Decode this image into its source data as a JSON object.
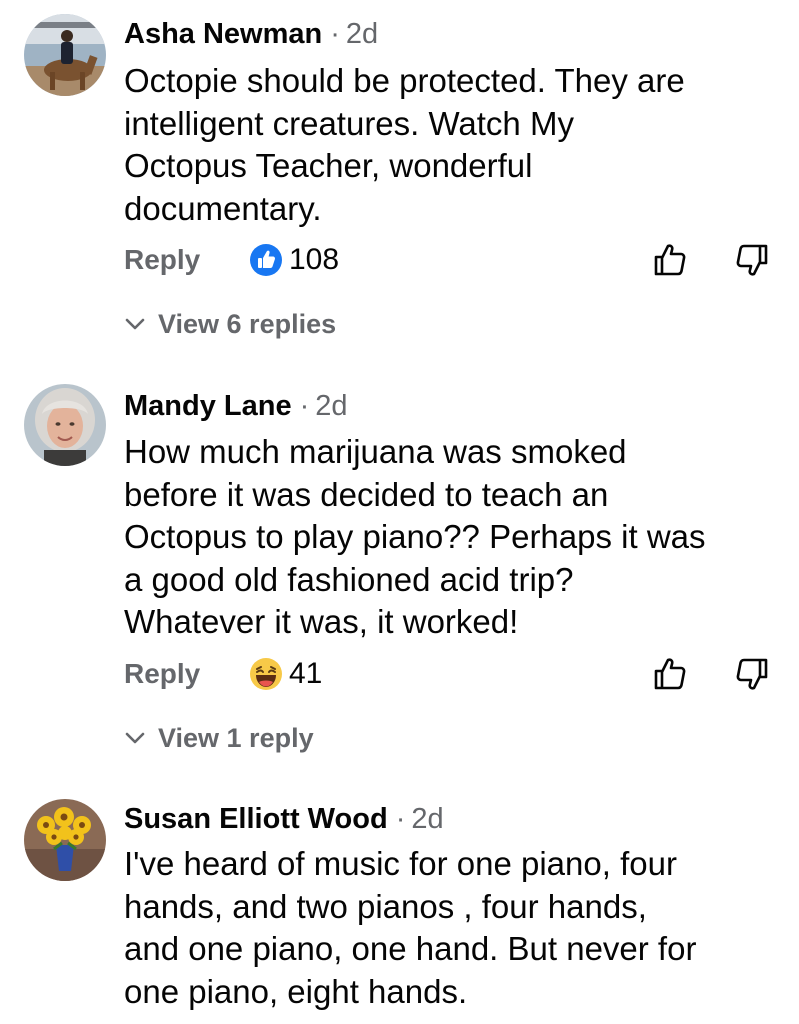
{
  "comments": [
    {
      "author": "Asha Newman",
      "separator": "·",
      "age": "2d",
      "avatar_icon": "person-with-horse-avatar",
      "lines": [
        "Octopie should be protected. They are",
        "intelligent creatures. Watch My",
        "Octopus Teacher, wonderful",
        "documentary."
      ],
      "reply_label": "Reply",
      "reaction_icon": "like-reaction-icon",
      "reaction_count": "108",
      "view_replies_label": "View 6 replies"
    },
    {
      "author": "Mandy Lane",
      "separator": "·",
      "age": "2d",
      "avatar_icon": "woman-portrait-avatar",
      "lines": [
        "How much marijuana was smoked",
        "before it was decided to teach an",
        "Octopus to play piano?? Perhaps it was",
        "a good old fashioned acid trip?",
        "Whatever it was, it worked!"
      ],
      "reply_label": "Reply",
      "reaction_icon": "haha-reaction-icon",
      "reaction_count": "41",
      "view_replies_label": "View 1 reply"
    },
    {
      "author": "Susan Elliott Wood",
      "separator": "·",
      "age": "2d",
      "avatar_icon": "sunflowers-avatar",
      "lines": [
        "I've heard of music for one piano, four",
        "hands, and two pianos , four hands,",
        "and one piano, one hand. But never for",
        "one piano, eight hands."
      ]
    }
  ],
  "colors": {
    "text_primary": "#050505",
    "text_secondary": "#65676b",
    "like_blue": "#1877f2",
    "haha_yellow": "#f7c948",
    "background": "#ffffff"
  }
}
